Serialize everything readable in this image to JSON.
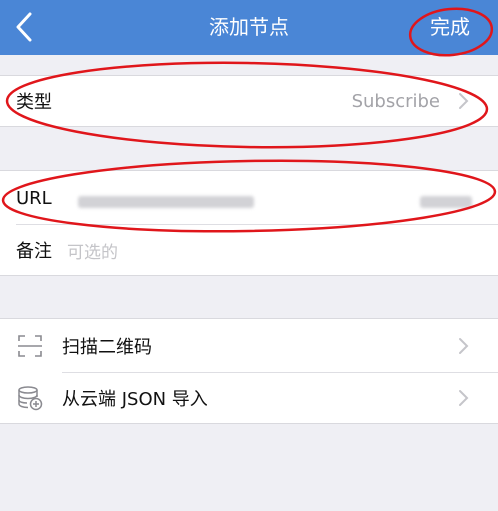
{
  "nav": {
    "title": "添加节点",
    "done_label": "完成"
  },
  "type_row": {
    "label": "类型",
    "value": "Subscribe"
  },
  "url_row": {
    "label": "URL"
  },
  "remark_row": {
    "label": "备注",
    "placeholder": "可选的"
  },
  "actions": [
    {
      "label": "扫描二维码",
      "icon": "scan-qr-icon"
    },
    {
      "label": "从云端 JSON 导入",
      "icon": "cloud-database-icon"
    }
  ],
  "colors": {
    "nav_bg": "#4a86d6",
    "page_bg": "#efeff4",
    "annotation": "#e0161b"
  }
}
